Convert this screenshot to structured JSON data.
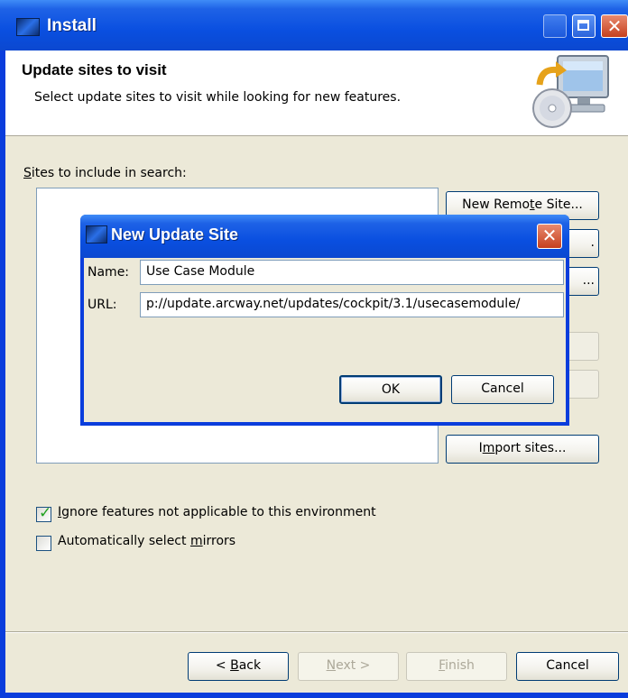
{
  "window": {
    "title": "Install"
  },
  "header": {
    "title": "Update sites to visit",
    "description": "Select update sites to visit while looking for new features."
  },
  "sites_label": {
    "pre": "",
    "mn": "S",
    "post": "ites to include in search:"
  },
  "side_buttons": {
    "new_remote": {
      "pre": "New Remo",
      "mn": "t",
      "post": "e Site..."
    },
    "import_sites": {
      "pre": "I",
      "mn": "m",
      "post": "port sites..."
    }
  },
  "options": {
    "ignore": {
      "pre": "",
      "mn": "I",
      "post": "gnore features not applicable to this environment",
      "checked": true
    },
    "mirrors": {
      "pre": "Automatically select ",
      "mn": "m",
      "post": "irrors",
      "checked": false
    }
  },
  "footer": {
    "back": {
      "pre": "< ",
      "mn": "B",
      "post": "ack"
    },
    "next": {
      "pre": "",
      "mn": "N",
      "post": "ext >"
    },
    "finish": {
      "pre": "",
      "mn": "F",
      "post": "inish"
    },
    "cancel": "Cancel"
  },
  "dialog": {
    "title": "New Update Site",
    "name_label": "Name:",
    "name_value": "Use Case Module",
    "url_label": "URL:",
    "url_value": "p://update.arcway.net/updates/cockpit/3.1/usecasemodule/",
    "ok": "OK",
    "cancel": "Cancel",
    "obscured_text": {
      "btn2": ".",
      "btn3": "..."
    }
  },
  "icons": {
    "app": "install-app-icon",
    "header": "computer-update-icon",
    "close": "close-icon",
    "minimize": "minimize-icon",
    "maximize": "maximize-icon",
    "check": "checkmark-icon"
  }
}
